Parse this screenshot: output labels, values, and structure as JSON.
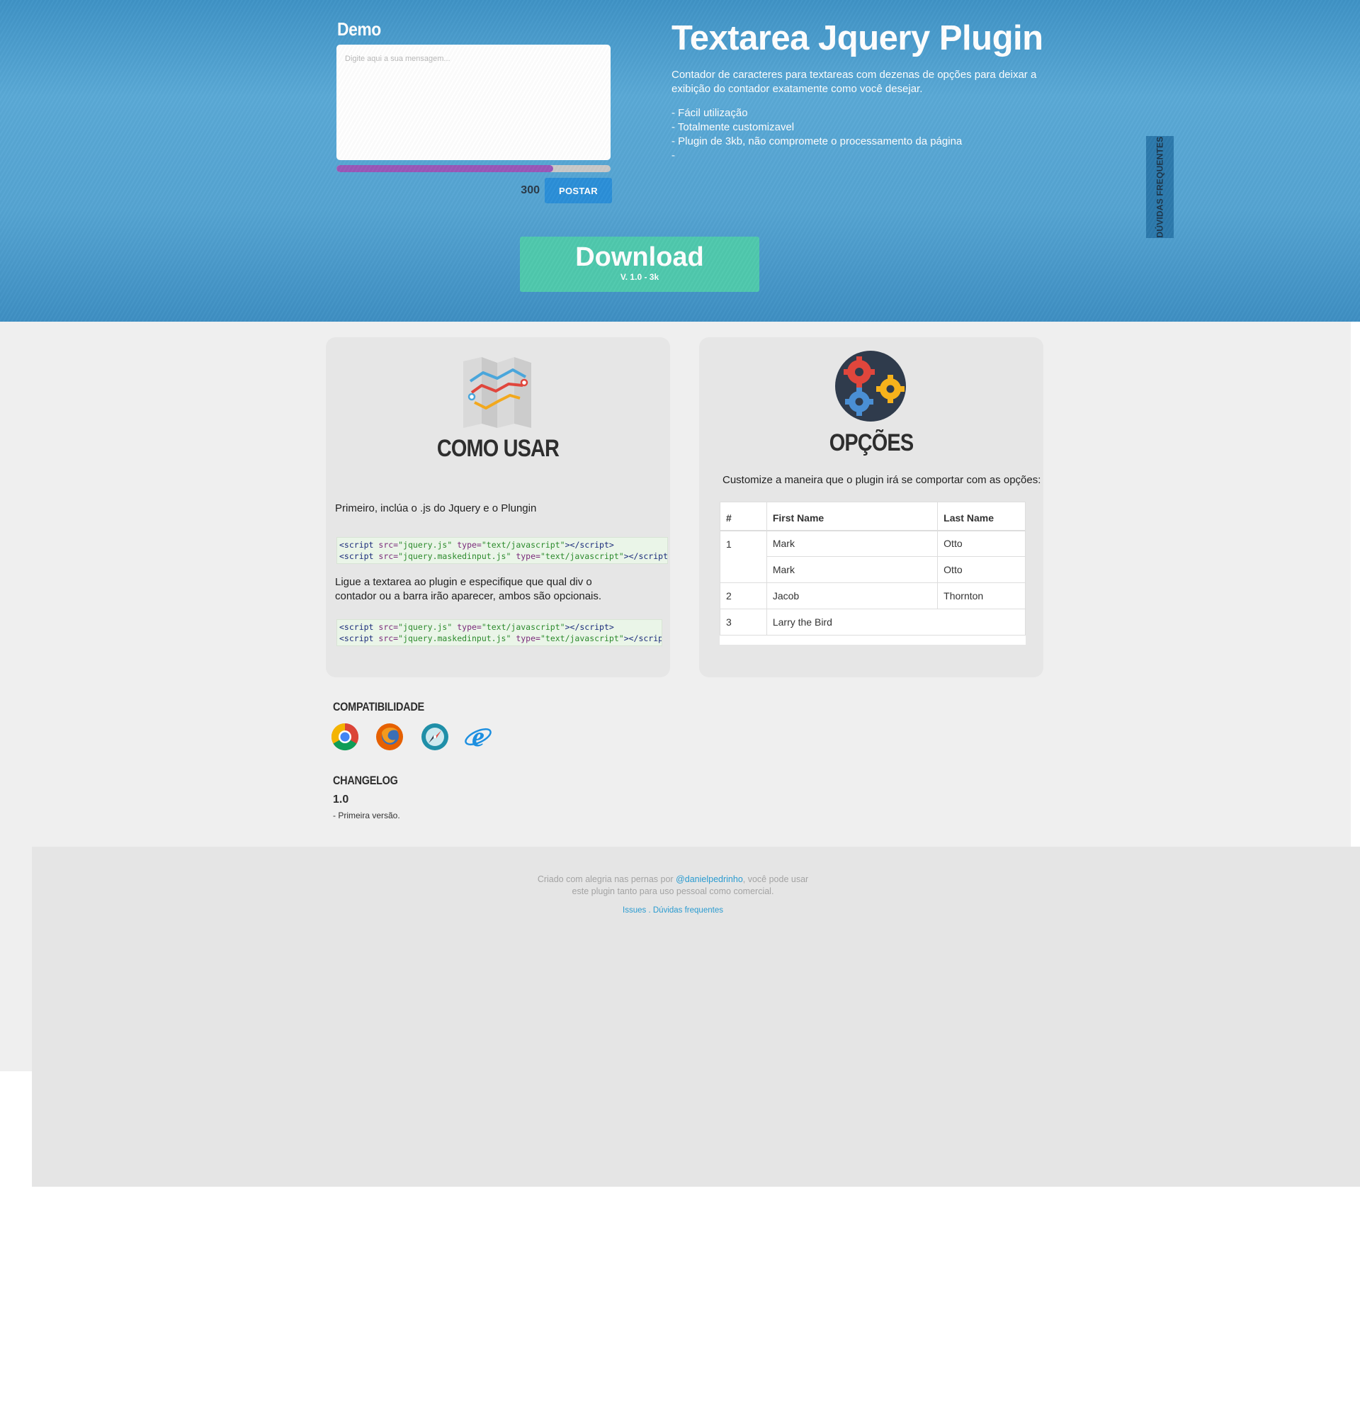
{
  "demo": {
    "title": "Demo",
    "placeholder": "Digite aqui a sua mensagem...",
    "progress_fraction": 0.79,
    "counter": "300",
    "post_label": "POSTAR"
  },
  "hero": {
    "title": "Textarea Jquery Plugin",
    "description": "Contador de caracteres para textareas com dezenas de opções para deixar a exibição do contador exatamente como você desejar.",
    "features": [
      "- Fácil utilização",
      "- Totalmente customizavel",
      "- Plugin de 3kb, não compromete o processamento da página"
    ],
    "faded_feature_prefix": "-",
    "faq_tab_label": "DÚVIDAS FREQUENTES"
  },
  "download": {
    "label": "Download",
    "version": "V. 1.0 - 3k"
  },
  "como_usar": {
    "title": "COMO USAR",
    "step1": "Primeiro, inclúa o .js do Jquery e o Plungin",
    "step2": "Ligue a textarea ao plugin e especifique que qual div o contador ou a barra irão aparecer, ambos são opcionais.",
    "code_lines": [
      {
        "src": "jquery.js",
        "type": "text/javascript"
      },
      {
        "src": "jquery.maskedinput.js",
        "type": "text/javascript"
      }
    ]
  },
  "opcoes": {
    "title": "OPÇÕES",
    "intro": "Customize a maneira que o plugin irá se comportar com as opções:",
    "table": {
      "headers": [
        "#",
        "First Name",
        "Last Name"
      ],
      "rows": [
        [
          "1",
          "Mark",
          "Otto"
        ],
        [
          "",
          "Mark",
          "Otto"
        ],
        [
          "2",
          "Jacob",
          "Thornton"
        ],
        [
          "3",
          "Larry the Bird",
          ""
        ]
      ]
    }
  },
  "compatibilidade": {
    "title": "COMPATIBILIDADE",
    "browsers": [
      "chrome-icon",
      "firefox-icon",
      "safari-icon",
      "internet-explorer-icon"
    ]
  },
  "changelog": {
    "title": "CHANGELOG",
    "version": "1.0",
    "entry": "- Primeira versão."
  },
  "footer": {
    "text_before": "Criado com alegria nas pernas por ",
    "author": "@danielpedrinho",
    "text_after": ", você pode usar",
    "text_line2": "este plugin tanto para uso pessoal como comercial.",
    "link_issues": "Issues",
    "link_separator": " . ",
    "link_faq": "Dúvidas frequentes"
  },
  "colors": {
    "hero_blue": "#4d9fd0",
    "progress_purple": "#9a57b8",
    "post_button": "#2b8fd8",
    "download_green": "#4fc9ad",
    "link_blue": "#2a9bd0"
  }
}
